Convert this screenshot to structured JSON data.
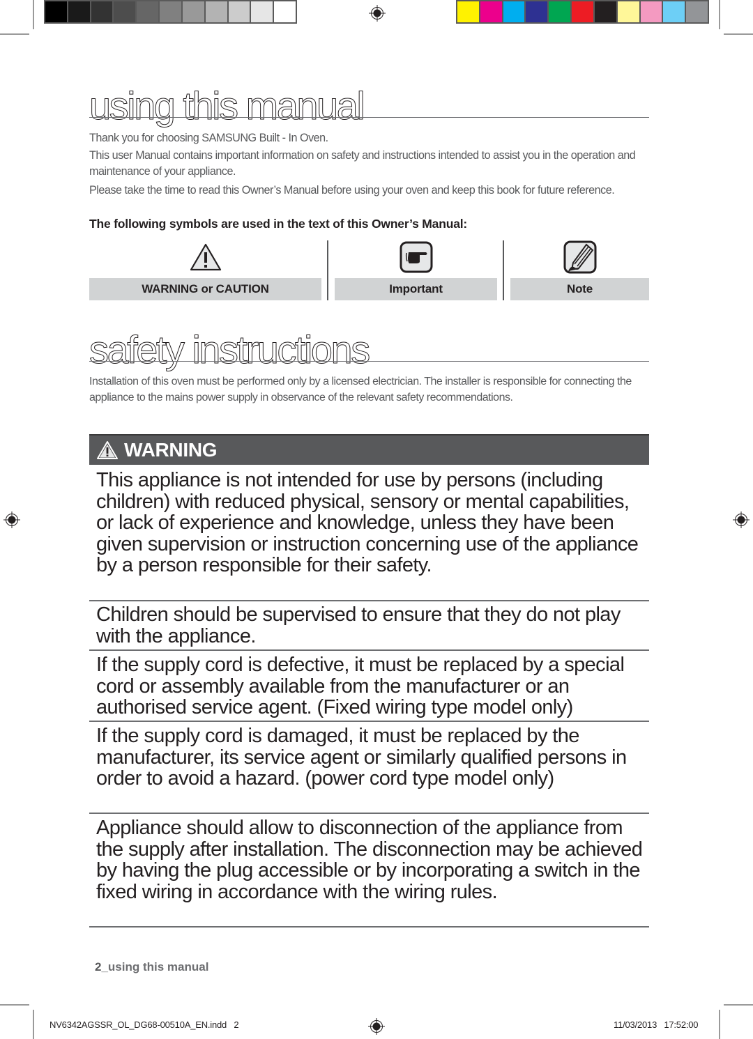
{
  "print_marks": {
    "gray_swatches": [
      "#000000",
      "#1a1a1a",
      "#333333",
      "#4d4d4d",
      "#666666",
      "#808080",
      "#999999",
      "#b3b3b3",
      "#cccccc",
      "#e6e6e6",
      "#ffffff"
    ],
    "color_swatches": [
      "#fff200",
      "#ec008c",
      "#00aeef",
      "#2e3192",
      "#00a651",
      "#ed1c24",
      "#231f20",
      "#fff799",
      "#f49ac1",
      "#6dcff6",
      "#939598"
    ]
  },
  "section1": {
    "title": "using this manual",
    "paragraphs": [
      "Thank you for choosing SAMSUNG Built - In Oven.",
      "This user Manual contains important information on safety and instructions intended to assist you in the operation and maintenance of your appliance.",
      "Please take the time to read this Owner’s Manual before using your oven and keep this book for future reference."
    ],
    "symbols_intro": "The following symbols are used in the text of this Owner’s Manual:",
    "symbols": [
      {
        "icon": "warning-triangle-icon",
        "label": "WARNING or CAUTION"
      },
      {
        "icon": "pointing-hand-icon",
        "label": "Important"
      },
      {
        "icon": "pencil-note-icon",
        "label": "Note"
      }
    ]
  },
  "section2": {
    "title": "safety instructions",
    "intro": "Installation of this oven must be performed only by a licensed electrician. The installer is responsible for connecting the appliance to the mains power supply in observance of the relevant safety recommendations.",
    "warning_label": "WARNING",
    "items": [
      "This appliance is not intended for use by persons (including children) with reduced physical, sensory or mental capabilities, or lack of experience and knowledge, unless they have been given supervision or instruction concerning use of the appliance by a person responsible for their safety.",
      "Children should be supervised to ensure that they do not play with the appliance.",
      "If the supply cord is defective, it must be replaced by a special cord or assembly available from the manufacturer or an authorised service agent. (Fixed wiring type model only)",
      "If the supply cord is damaged, it must be replaced by the manufacturer, its service agent or similarly qualified persons in order to avoid a hazard. (power cord type model only)",
      "Appliance should allow to disconnection of the appliance from the supply after installation. The disconnection may be achieved by having the plug accessible or by incorporating a switch in the fixed wiring in accordance with the wiring rules."
    ]
  },
  "footer": {
    "page_number": "2",
    "page_section": "_using this manual",
    "slug_file": "NV6342AGSSR_OL_DG68-00510A_EN.indd   2",
    "slug_date": "11/03/2013   17:52:00"
  }
}
